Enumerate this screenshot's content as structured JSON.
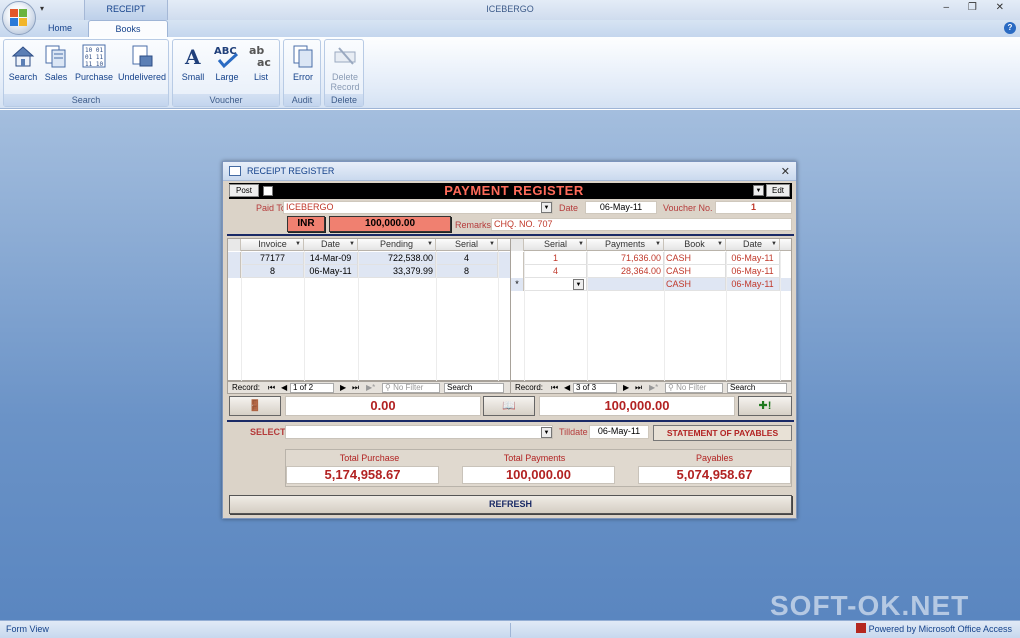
{
  "app": {
    "title": "ICEBERGO",
    "context_tab": "RECEIPT REGISTER",
    "tabs": [
      "Home",
      "Books"
    ],
    "win_controls": "–  ❐  ✕"
  },
  "ribbon": {
    "groups": [
      {
        "label": "Search",
        "buttons": [
          "Search",
          "Sales",
          "Purchase",
          "Undelivered"
        ]
      },
      {
        "label": "Voucher",
        "buttons": [
          "Small",
          "Large",
          "List"
        ]
      },
      {
        "label": "Audit",
        "buttons": [
          "Error"
        ]
      },
      {
        "label": "Delete",
        "buttons": [
          "Delete Record"
        ]
      }
    ],
    "delete_line1": "Delete",
    "delete_line2": "Record"
  },
  "form": {
    "title": "RECEIPT REGISTER",
    "header_title": "PAYMENT REGISTER",
    "post_label": "Post",
    "edit_label": "Edt",
    "paid_to_label": "Paid To",
    "paid_to_value": "ICEBERGO",
    "date_label": "Date",
    "date_value": "06-May-11",
    "voucher_label": "Voucher No.",
    "voucher_value": "1",
    "currency": "INR",
    "amount": "100,000.00",
    "remarks_label": "Remarks",
    "remarks_value": "CHQ. NO. 707"
  },
  "left_grid": {
    "columns": [
      "Invoice",
      "Date",
      "Pending",
      "Serial"
    ],
    "rows": [
      [
        "77177",
        "14-Mar-09",
        "722,538.00",
        "4"
      ],
      [
        "8",
        "06-May-11",
        "33,379.99",
        "8"
      ]
    ],
    "nav": {
      "label": "Record:",
      "position": "1 of 2",
      "filter": "No Filter",
      "search": "Search"
    }
  },
  "right_grid": {
    "columns": [
      "Serial",
      "Payments",
      "Book",
      "Date"
    ],
    "rows": [
      [
        "1",
        "71,636.00",
        "CASH",
        "06-May-11"
      ],
      [
        "4",
        "28,364.00",
        "CASH",
        "06-May-11"
      ]
    ],
    "new_row": {
      "marker": "*",
      "book": "CASH",
      "date": "06-May-11"
    },
    "nav": {
      "label": "Record:",
      "position": "3 of 3",
      "filter": "No Filter",
      "search": "Search"
    }
  },
  "summary": {
    "left_value": "0.00",
    "right_value": "100,000.00"
  },
  "select": {
    "label": "SELECT",
    "tilldate_label": "Tilldate",
    "tilldate_value": "06-May-11",
    "statement_button": "STATEMENT OF PAYABLES"
  },
  "totals": {
    "purchase_label": "Total Purchase",
    "purchase_value": "5,174,958.67",
    "payments_label": "Total Payments",
    "payments_value": "100,000.00",
    "payables_label": "Payables",
    "payables_value": "5,074,958.67"
  },
  "refresh_label": "REFRESH",
  "status": {
    "left": "Form View",
    "right": "Powered by Microsoft Office Access"
  },
  "watermark": "SOFT-OK.NET",
  "colors": {
    "header_red": "#ff6b5a",
    "value_red": "#b22222",
    "accent_blue": "#15428b",
    "amount_bg": "#f08070"
  }
}
